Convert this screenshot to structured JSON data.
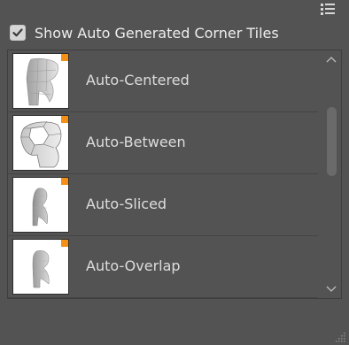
{
  "panel": {
    "show_auto_tiles_label": "Show Auto Generated Corner Tiles",
    "show_auto_tiles_checked": true
  },
  "tiles": [
    {
      "label": "Auto-Centered"
    },
    {
      "label": "Auto-Between"
    },
    {
      "label": "Auto-Sliced"
    },
    {
      "label": "Auto-Overlap"
    }
  ],
  "icons": {
    "panel_menu": "hamburger-menu-icon",
    "scroll_up": "chevron-up-icon",
    "scroll_down": "chevron-down-icon",
    "resize": "resize-grip-icon"
  },
  "colors": {
    "panel_bg": "#535353",
    "accent_flag": "#f39015",
    "text": "#dddddd"
  }
}
